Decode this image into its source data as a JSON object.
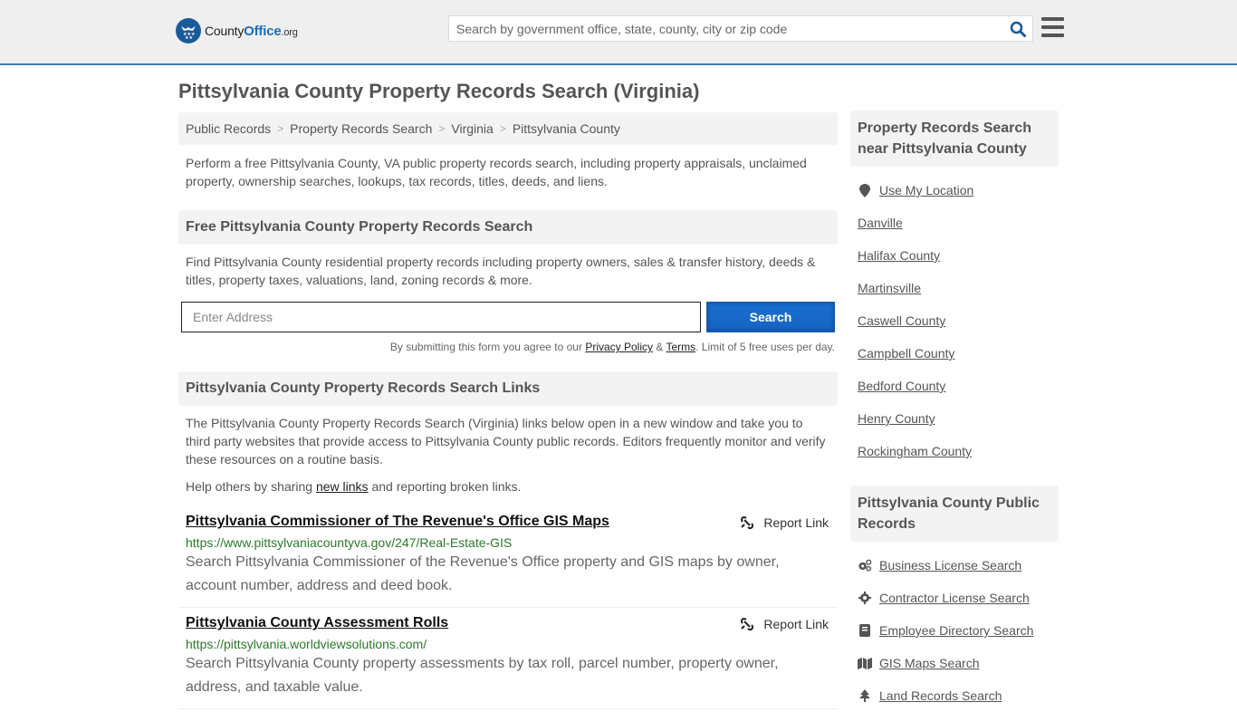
{
  "header": {
    "logo": {
      "prefix": "County",
      "brand": "Office",
      "tld": ".org"
    },
    "search_placeholder": "Search by government office, state, county, city or zip code"
  },
  "page": {
    "title": "Pittsylvania County Property Records Search (Virginia)",
    "breadcrumb": [
      "Public Records",
      "Property Records Search",
      "Virginia",
      "Pittsylvania County"
    ],
    "intro": "Perform a free Pittsylvania County, VA public property records search, including property appraisals, unclaimed property, ownership searches, lookups, tax records, titles, deeds, and liens."
  },
  "free_search": {
    "heading": "Free Pittsylvania County Property Records Search",
    "description": "Find Pittsylvania County residential property records including property owners, sales & transfer history, deeds & titles, property taxes, valuations, land, zoning records & more.",
    "address_placeholder": "Enter Address",
    "button_label": "Search",
    "terms_prefix": "By submitting this form you agree to our ",
    "privacy_label": "Privacy Policy",
    "terms_amp": " & ",
    "terms_label": "Terms",
    "terms_suffix": ". Limit of 5 free uses per day."
  },
  "links_section": {
    "heading": "Pittsylvania County Property Records Search Links",
    "description": "The Pittsylvania County Property Records Search (Virginia) links below open in a new window and take you to third party websites that provide access to Pittsylvania County public records. Editors frequently monitor and verify these resources on a routine basis.",
    "help_prefix": "Help others by sharing ",
    "help_link": "new links",
    "help_suffix": " and reporting broken links.",
    "report_label": "Report Link",
    "items": [
      {
        "title": "Pittsylvania Commissioner of The Revenue's Office GIS Maps",
        "url": "https://www.pittsylvaniacountyva.gov/247/Real-Estate-GIS",
        "description": "Search Pittsylvania Commissioner of the Revenue's Office property and GIS maps by owner, account number, address and deed book."
      },
      {
        "title": "Pittsylvania County Assessment Rolls",
        "url": "https://pittsylvania.worldviewsolutions.com/",
        "description": "Search Pittsylvania County property assessments by tax roll, parcel number, property owner, address, and taxable value."
      }
    ]
  },
  "sidebar": {
    "nearby": {
      "heading": "Property Records Search near Pittsylvania County",
      "use_location": "Use My Location",
      "items": [
        "Danville",
        "Halifax County",
        "Martinsville",
        "Caswell County",
        "Campbell County",
        "Bedford County",
        "Henry County",
        "Rockingham County"
      ]
    },
    "public_records": {
      "heading": "Pittsylvania County Public Records",
      "items": [
        {
          "label": "Business License Search",
          "icon": "cogs-icon"
        },
        {
          "label": "Contractor License Search",
          "icon": "gear-icon"
        },
        {
          "label": "Employee Directory Search",
          "icon": "book-icon"
        },
        {
          "label": "GIS Maps Search",
          "icon": "map-icon"
        },
        {
          "label": "Land Records Search",
          "icon": "tree-icon"
        }
      ]
    }
  },
  "colors": {
    "accent": "#3b7cb0",
    "button": "#1a6bcc",
    "url_green": "#2a7a2a"
  }
}
